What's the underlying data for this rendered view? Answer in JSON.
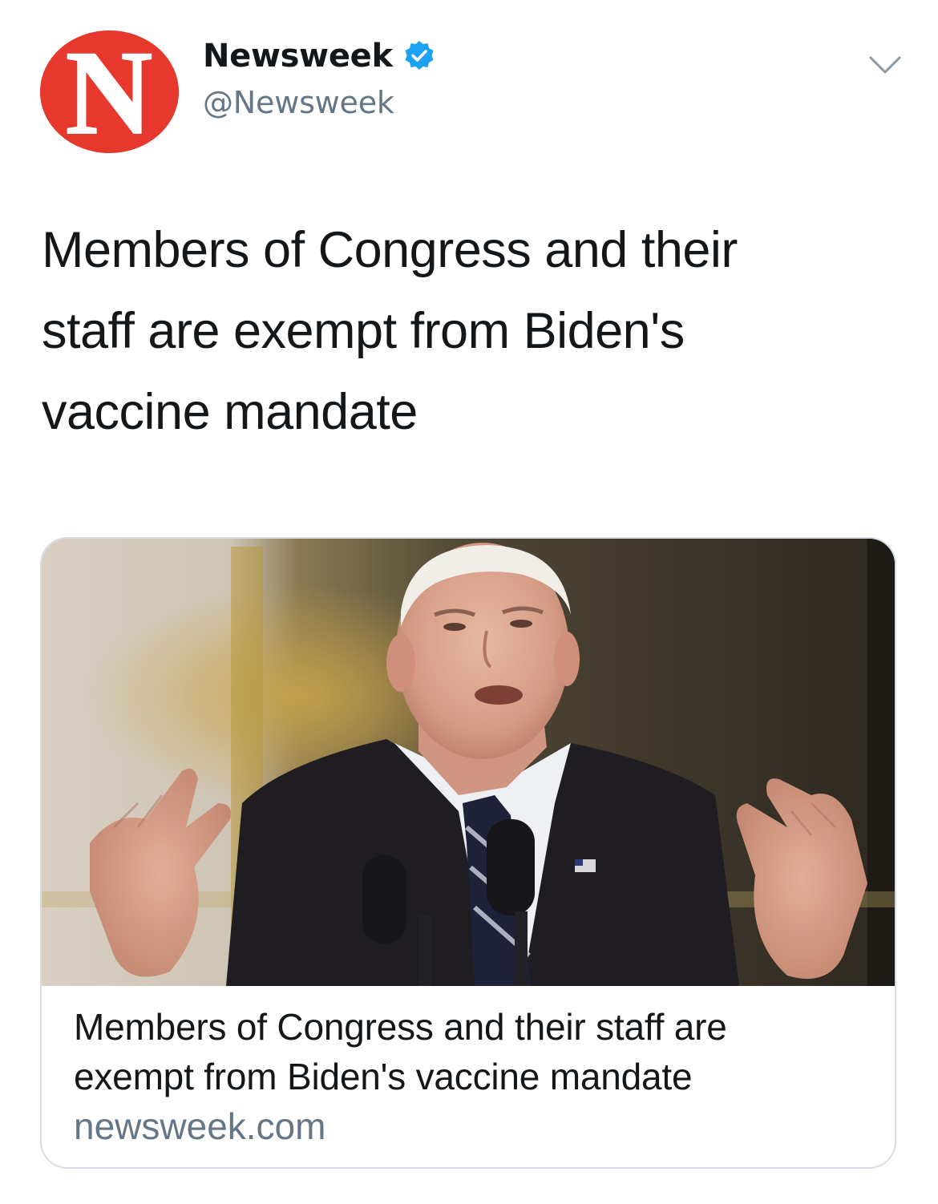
{
  "author": {
    "display_name": "Newsweek",
    "handle": "@Newsweek",
    "avatar_letter": "N",
    "avatar_icon": "newsweek-logo",
    "verified": true,
    "verified_icon": "verified-badge-icon"
  },
  "menu": {
    "icon": "chevron-down-icon"
  },
  "tweet": {
    "lines": [
      "Members of Congress and their",
      "staff are exempt from Biden's",
      "vaccine mandate"
    ]
  },
  "card": {
    "title_lines": [
      "Members of Congress and their staff are",
      "exempt from Biden's vaccine mandate"
    ],
    "domain": "newsweek.com",
    "image_icon": "article-photo"
  },
  "colors": {
    "brand_red": "#e7382e",
    "verified_blue": "#1da1f2",
    "text_primary": "#14171a",
    "text_secondary": "#657786",
    "card_border": "#d6dce1"
  }
}
